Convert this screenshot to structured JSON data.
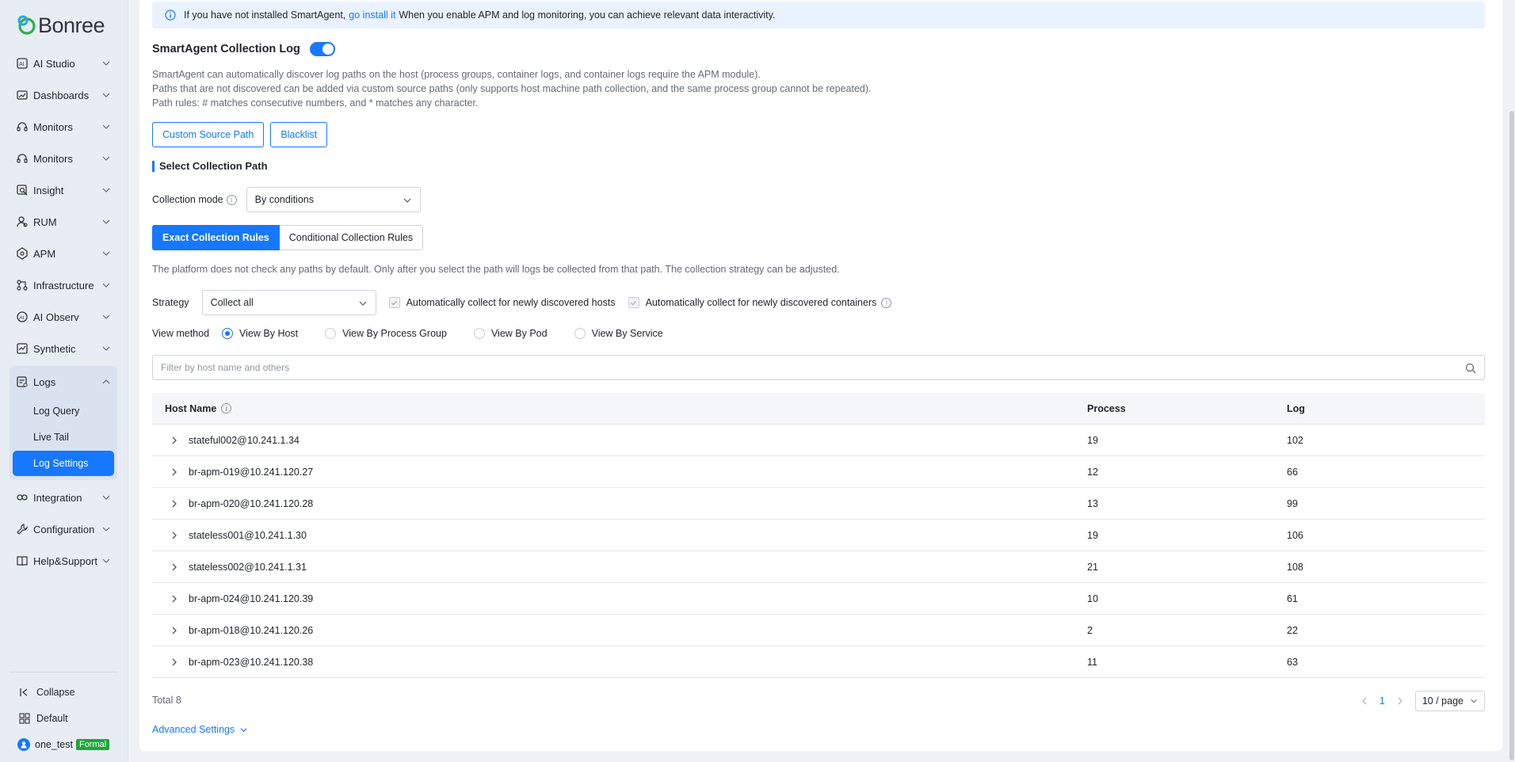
{
  "brand": {
    "logo_text": "Bonree"
  },
  "sidebar": {
    "items": [
      {
        "label": "AI Studio",
        "icon": "ai-studio-icon"
      },
      {
        "label": "Dashboards",
        "icon": "dashboard-icon"
      },
      {
        "label": "Monitors",
        "icon": "headset-icon"
      },
      {
        "label": "Monitors",
        "icon": "headset-icon"
      },
      {
        "label": "Insight",
        "icon": "insight-icon"
      },
      {
        "label": "RUM",
        "icon": "rum-icon"
      },
      {
        "label": "APM",
        "icon": "apm-icon"
      },
      {
        "label": "Infrastructure",
        "icon": "infrastructure-icon"
      },
      {
        "label": "AI Observ",
        "icon": "ai-observ-icon"
      },
      {
        "label": "Synthetic",
        "icon": "synthetic-icon"
      }
    ],
    "logs": {
      "label": "Logs",
      "subitems": [
        "Log Query",
        "Live Tail",
        "Log Settings"
      ],
      "active": "Log Settings"
    },
    "items_after": [
      {
        "label": "Integration",
        "icon": "integration-icon"
      },
      {
        "label": "Configuration",
        "icon": "wrench-icon"
      },
      {
        "label": "Help&Support",
        "icon": "book-icon"
      }
    ],
    "bottom": {
      "collapse": "Collapse",
      "workspace": "Default",
      "user": "one_test",
      "user_badge": "Formal"
    }
  },
  "notice": {
    "before": "If you have not installed SmartAgent,",
    "link": "go install it",
    "after": "When you enable APM and log monitoring, you can achieve relevant data interactivity."
  },
  "header": {
    "title": "SmartAgent Collection Log",
    "toggle_on": true
  },
  "description": [
    "SmartAgent can automatically discover log paths on the host (process groups, container logs, and container logs require the APM module).",
    "Paths that are not discovered can be added via custom source paths (only supports host machine path collection, and the same process group cannot be repeated).",
    "Path rules: # matches consecutive numbers, and * matches any character."
  ],
  "buttons": {
    "custom_source": "Custom Source Path",
    "blacklist": "Blacklist"
  },
  "section": {
    "title": "Select Collection Path"
  },
  "collection_mode": {
    "label": "Collection mode",
    "value": "By conditions"
  },
  "rule_tabs": {
    "exact": "Exact Collection Rules",
    "conditional": "Conditional Collection Rules",
    "active": "exact"
  },
  "platform_note": "The platform does not check any paths by default. Only after you select the path will logs be collected from that path. The collection strategy can be adjusted.",
  "strategy": {
    "label": "Strategy",
    "value": "Collect all",
    "auto_hosts": "Automatically collect for newly discovered hosts",
    "auto_containers": "Automatically collect for newly discovered containers"
  },
  "view_method": {
    "label": "View method",
    "options": [
      "View By Host",
      "View By Process Group",
      "View By Pod",
      "View By Service"
    ],
    "selected": "View By Host"
  },
  "filter": {
    "placeholder": "Filter by host name and others"
  },
  "table": {
    "columns": [
      "Host Name",
      "Process",
      "Log"
    ],
    "rows": [
      {
        "host": "stateful002@10.241.1.34",
        "process": "19",
        "log": "102"
      },
      {
        "host": "br-apm-019@10.241.120.27",
        "process": "12",
        "log": "66"
      },
      {
        "host": "br-apm-020@10.241.120.28",
        "process": "13",
        "log": "99"
      },
      {
        "host": "stateless001@10.241.1.30",
        "process": "19",
        "log": "106"
      },
      {
        "host": "stateless002@10.241.1.31",
        "process": "21",
        "log": "108"
      },
      {
        "host": "br-apm-024@10.241.120.39",
        "process": "10",
        "log": "61"
      },
      {
        "host": "br-apm-018@10.241.120.26",
        "process": "2",
        "log": "22"
      },
      {
        "host": "br-apm-023@10.241.120.38",
        "process": "11",
        "log": "63"
      }
    ]
  },
  "pagination": {
    "total": "Total 8",
    "current_page": "1",
    "page_size": "10 / page"
  },
  "advanced": {
    "label": "Advanced Settings"
  },
  "colors": {
    "accent": "#1677ff",
    "badge_green": "#20a53a"
  }
}
